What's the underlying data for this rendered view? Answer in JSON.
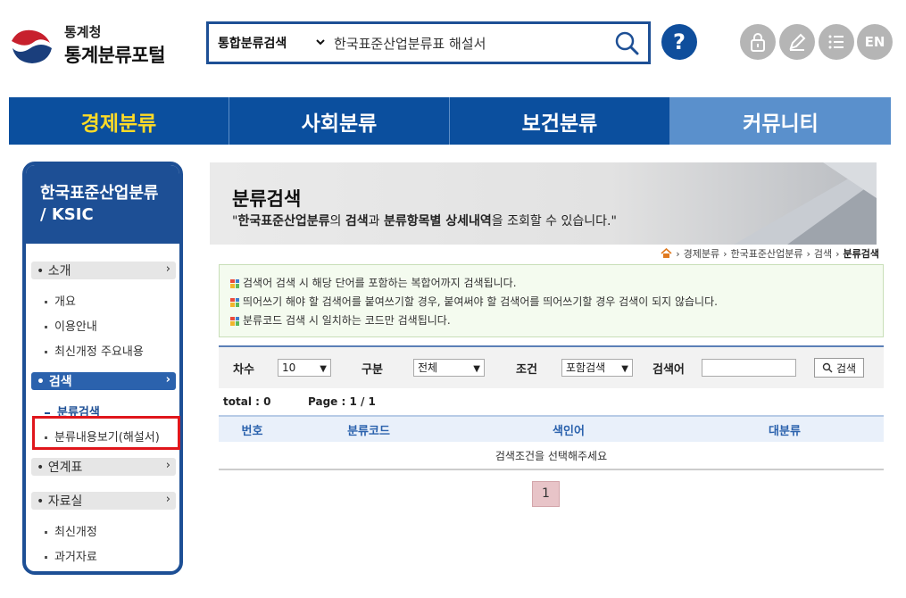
{
  "header": {
    "logo_sub": "통계청",
    "logo_main": "통계분류포털",
    "search_category": "통합분류검색",
    "search_value": "한국표준산업분류표 해설서",
    "help_label": "?",
    "en_label": "EN"
  },
  "gnb": [
    "경제분류",
    "사회분류",
    "보건분류",
    "커뮤니티"
  ],
  "lnb": {
    "title_line1": "한국표준산업분류",
    "title_line2": "/ KSIC",
    "groups": [
      {
        "label": "• 소개",
        "arrow": "›",
        "items": [
          "개요",
          "이용안내",
          "최신개정 주요내용"
        ]
      },
      {
        "label": "• 검색",
        "arrow": "›",
        "items": [
          "분류검색",
          "분류내용보기(해설서)"
        ]
      },
      {
        "label": "• 연계표",
        "arrow": "›",
        "items": []
      },
      {
        "label": "• 자료실",
        "arrow": "›",
        "items": [
          "최신개정",
          "과거자료"
        ]
      }
    ]
  },
  "banner": {
    "title": "분류검색",
    "desc_q1": "\"",
    "desc_b1": "한국표준산업분류",
    "desc_t1": "의 ",
    "desc_b2": "검색",
    "desc_t2": "과 ",
    "desc_b3": "분류항목별 상세내역",
    "desc_t3": "을 조회할 수 있습니다.\""
  },
  "breadcrumb": [
    "경제분류",
    "한국표준산업분류",
    "검색",
    "분류검색"
  ],
  "notice": [
    "검색어 검색 시 해당 단어를 포함하는 복합어까지 검색됩니다.",
    "띄어쓰기 해야 할 검색어를 붙여쓰기할 경우, 붙여써야 할 검색어를 띄어쓰기할 경우 검색이 되지 않습니다.",
    "분류코드 검색 시 일치하는 코드만 검색됩니다."
  ],
  "filter": {
    "order_label": "차수",
    "order_value": "10",
    "type_label": "구분",
    "type_value": "전체",
    "cond_label": "조건",
    "cond_value": "포함검색",
    "keyword_label": "검색어",
    "keyword_value": "",
    "search_button": "검색"
  },
  "meta": {
    "total": "total : 0",
    "page": "Page : 1 / 1"
  },
  "table": {
    "columns": [
      "번호",
      "분류코드",
      "색인어",
      "대분류"
    ],
    "empty_message": "검색조건을 선택해주세요"
  },
  "pagination": {
    "current": "1"
  }
}
